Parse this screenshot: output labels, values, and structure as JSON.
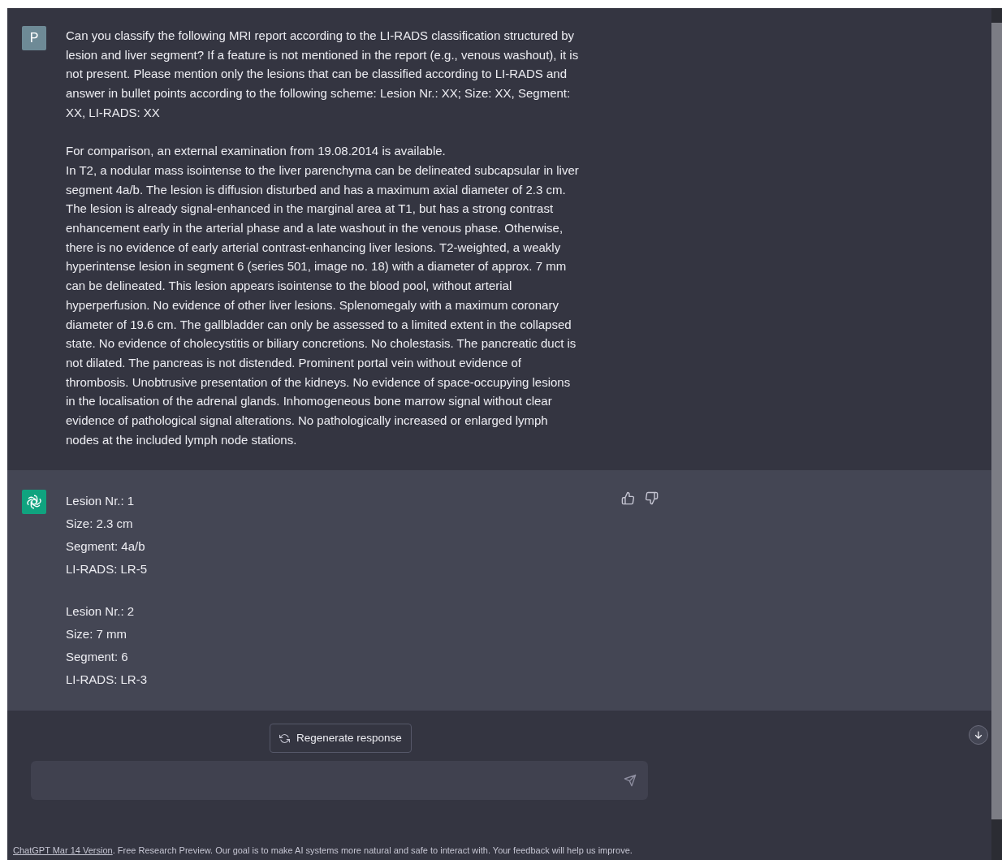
{
  "messages": [
    {
      "kind": "user",
      "avatar": "P",
      "paragraphs": [
        "Can you classify the following MRI report according to the LI-RADS classification structured by lesion and liver segment? If a feature is not mentioned in the report (e.g., venous washout), it is not present. Please mention only the lesions that can be classified according to LI-RADS and answer in bullet points according to the following scheme: Lesion Nr.: XX; Size: XX, Segment: XX, LI-RADS: XX",
        "For comparison, an external examination from 19.08.2014 is available.",
        "In T2, a nodular mass isointense to the liver parenchyma can be delineated subcapsular in liver segment 4a/b. The lesion is diffusion disturbed and has a maximum axial diameter of 2.3 cm. The lesion is already signal-enhanced in the marginal area at T1, but has a strong contrast enhancement early in the arterial phase and a late washout in the venous phase. Otherwise, there is no evidence of early arterial contrast-enhancing liver lesions. T2-weighted, a weakly hyperintense lesion in segment 6 (series 501, image no. 18) with a diameter of approx. 7 mm can be delineated. This lesion appears isointense to the blood pool, without arterial hyperperfusion. No evidence of other liver lesions. Splenomegaly with a maximum coronary diameter of 19.6 cm. The gallbladder can only be assessed to a limited extent in the collapsed state. No evidence of cholecystitis or biliary concretions. No cholestasis. The pancreatic duct is not dilated. The pancreas is not distended. Prominent portal vein without evidence of thrombosis. Unobtrusive presentation of the kidneys. No evidence of space-occupying lesions in the localisation of the adrenal glands. Inhomogeneous bone marrow signal without clear evidence of pathological signal alterations. No pathologically increased or enlarged lymph nodes at the included lymph node stations."
      ]
    },
    {
      "kind": "assistant",
      "lesions": [
        [
          "Lesion Nr.: 1",
          "Size: 2.3 cm",
          "Segment: 4a/b",
          "LI-RADS: LR-5"
        ],
        [
          "Lesion Nr.: 2",
          "Size: 7 mm",
          "Segment: 6",
          "LI-RADS: LR-3"
        ]
      ]
    }
  ],
  "regenerate_button": "Regenerate response",
  "footer": {
    "link": "ChatGPT Mar 14 Version",
    "text": ". Free Research Preview. Our goal is to make AI systems more natural and safe to interact with. Your feedback will help us improve."
  }
}
